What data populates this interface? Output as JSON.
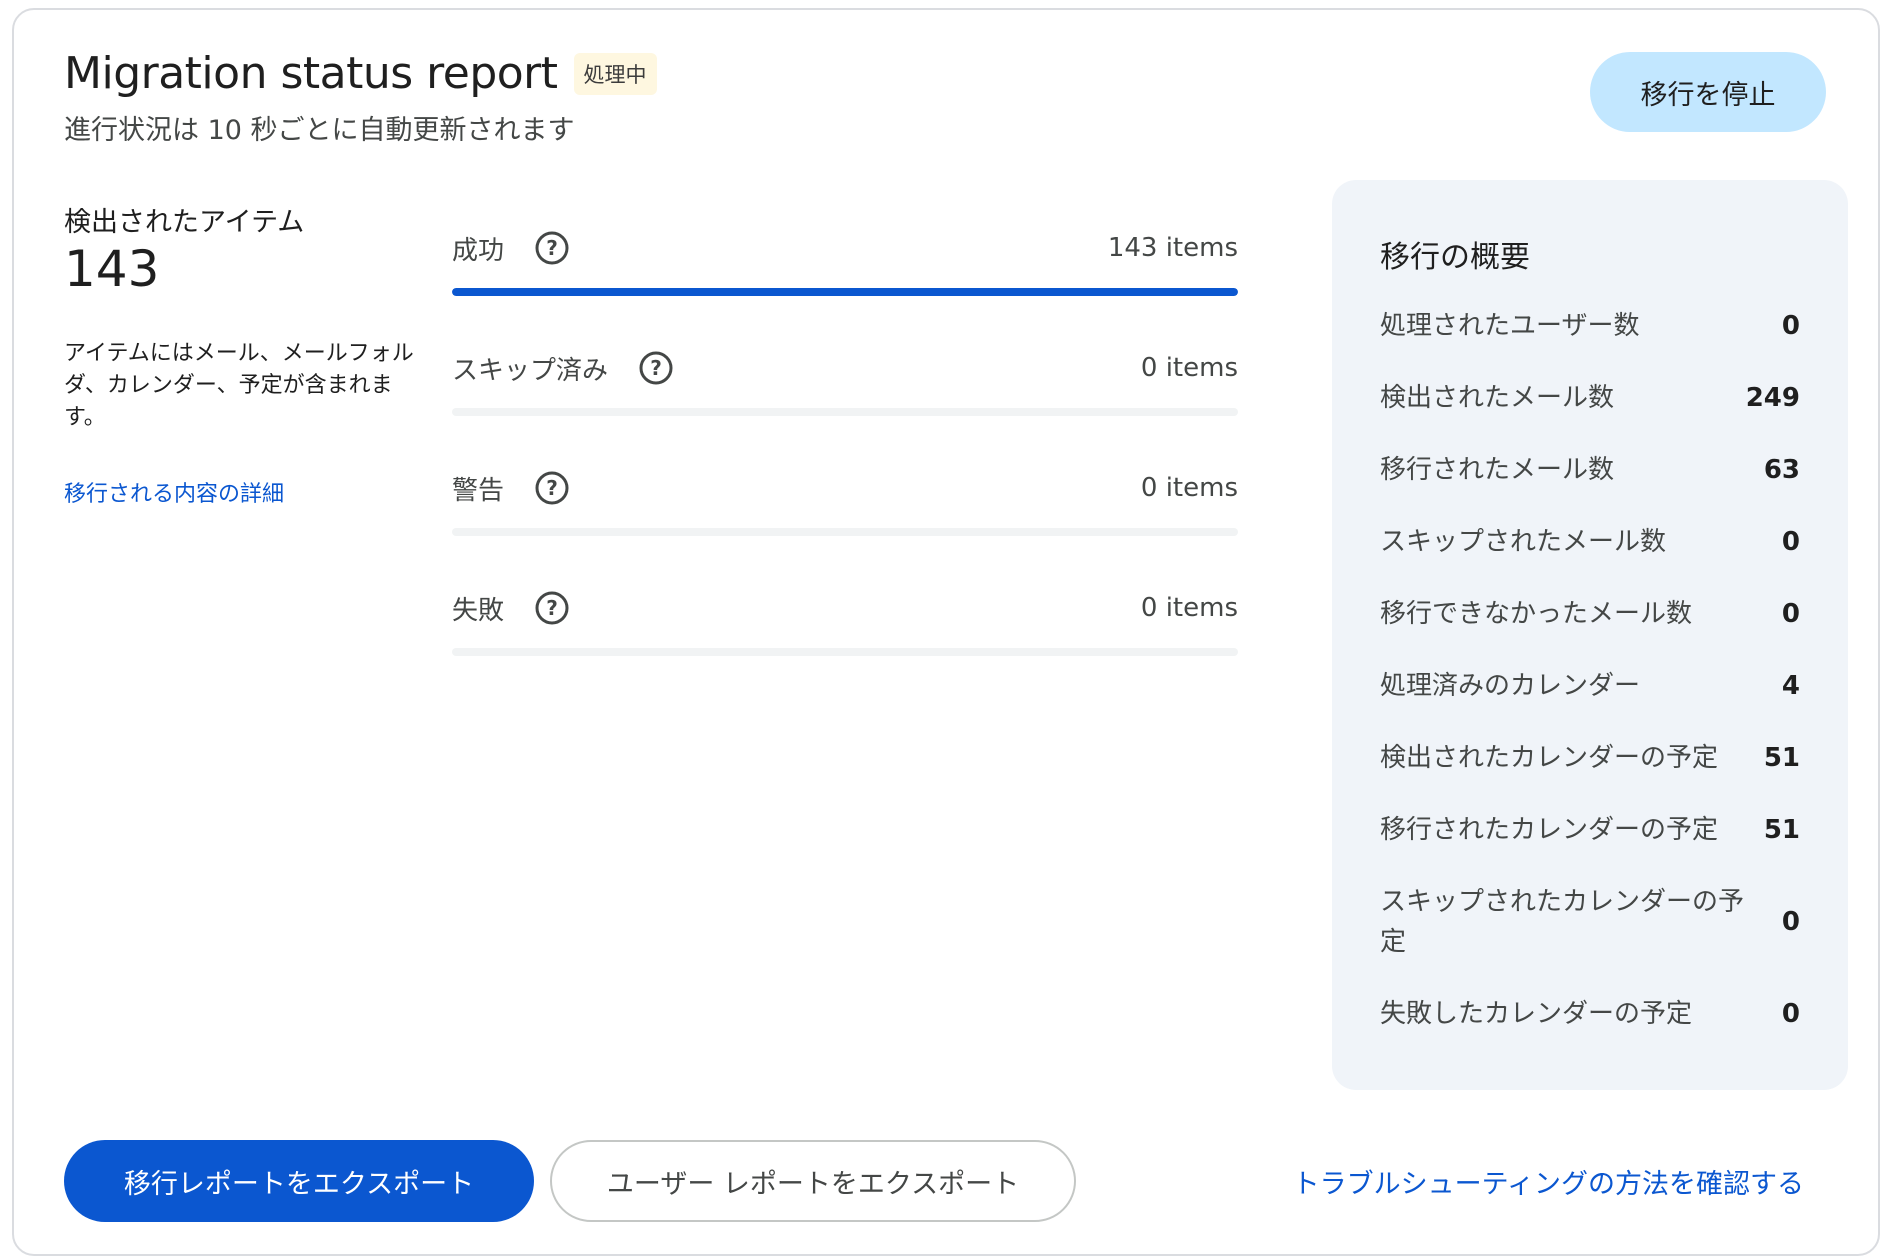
{
  "header": {
    "title": "Migration status report",
    "status_badge": "処理中",
    "subtitle": "進行状況は 10 秒ごとに自動更新されます",
    "stop_button": "移行を停止"
  },
  "found_items": {
    "label": "検出されたアイテム",
    "count": "143",
    "description": "アイテムにはメール、メールフォルダ、カレンダー、予定が含まれます。",
    "details_link": "移行される内容の詳細"
  },
  "progress": [
    {
      "label": "成功",
      "count": "143 items",
      "fill_percent": 100,
      "help_icon": "help-circle-icon"
    },
    {
      "label": "スキップ済み",
      "count": "0 items",
      "fill_percent": 0,
      "help_icon": "help-circle-icon"
    },
    {
      "label": "警告",
      "count": "0 items",
      "fill_percent": 0,
      "help_icon": "help-circle-icon"
    },
    {
      "label": "失敗",
      "count": "0 items",
      "fill_percent": 0,
      "help_icon": "help-circle-icon"
    }
  ],
  "summary": {
    "title": "移行の概要",
    "rows": [
      {
        "label": "処理されたユーザー数",
        "value": "0"
      },
      {
        "label": "検出されたメール数",
        "value": "249"
      },
      {
        "label": "移行されたメール数",
        "value": "63"
      },
      {
        "label": "スキップされたメール数",
        "value": "0"
      },
      {
        "label": "移行できなかったメール数",
        "value": "0"
      },
      {
        "label": "処理済みのカレンダー",
        "value": "4"
      },
      {
        "label": "検出されたカレンダーの予定",
        "value": "51"
      },
      {
        "label": "移行されたカレンダーの予定",
        "value": "51"
      },
      {
        "label": "スキップされたカレンダーの予定",
        "value": "0"
      },
      {
        "label": "失敗したカレンダーの予定",
        "value": "0"
      }
    ]
  },
  "footer": {
    "export_migration_report": "移行レポートをエクスポート",
    "export_user_report": "ユーザー レポートをエクスポート",
    "troubleshoot_link": "トラブルシューティングの方法を確認する"
  },
  "colors": {
    "accent": "#0b57d0",
    "stop_button_bg": "#c2e7ff",
    "badge_bg": "#fef7e0",
    "summary_bg": "#f0f4f9"
  }
}
